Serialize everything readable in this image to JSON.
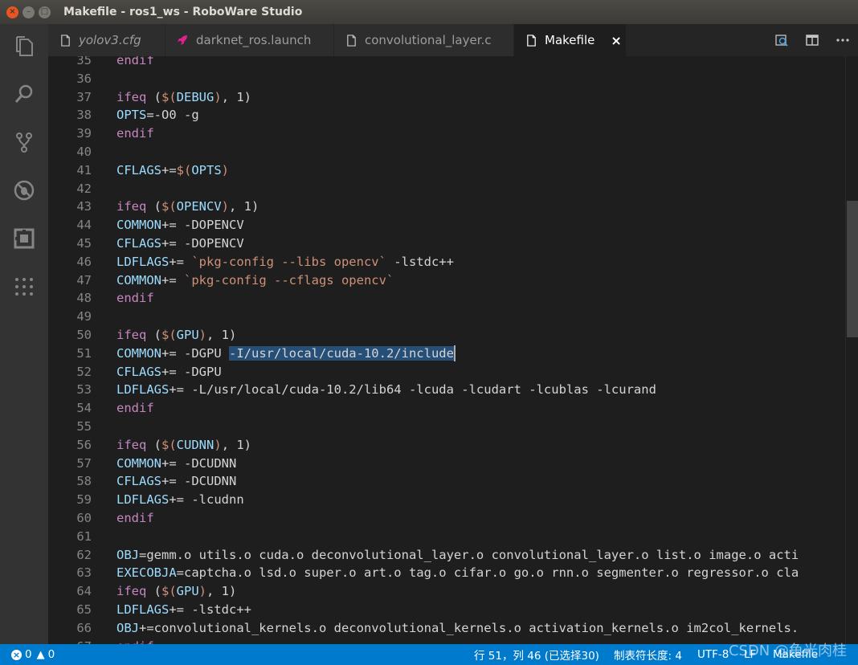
{
  "window": {
    "title": "Makefile - ros1_ws - RoboWare Studio"
  },
  "activity_bar": [
    {
      "icon": "files-icon"
    },
    {
      "icon": "search-icon"
    },
    {
      "icon": "source-control-icon"
    },
    {
      "icon": "debug-icon"
    },
    {
      "icon": "extensions-icon"
    },
    {
      "icon": "more-icon"
    }
  ],
  "tabs": [
    {
      "label": "yolov3.cfg",
      "icon": "file-icon",
      "italic": true,
      "active": false
    },
    {
      "label": "darknet_ros.launch",
      "icon": "rocket-icon",
      "italic": false,
      "active": false
    },
    {
      "label": "convolutional_layer.c",
      "icon": "file-icon",
      "italic": false,
      "active": false
    },
    {
      "label": "Makefile",
      "icon": "file-icon",
      "italic": false,
      "active": true,
      "close": "×"
    }
  ],
  "editor": {
    "lines": [
      {
        "n": "35",
        "text": "endif"
      },
      {
        "n": "36",
        "text": ""
      },
      {
        "n": "37",
        "text": "ifeq ($(DEBUG), 1)"
      },
      {
        "n": "38",
        "text": "OPTS=-O0 -g"
      },
      {
        "n": "39",
        "text": "endif"
      },
      {
        "n": "40",
        "text": ""
      },
      {
        "n": "41",
        "text": "CFLAGS+=$(OPTS)"
      },
      {
        "n": "42",
        "text": ""
      },
      {
        "n": "43",
        "text": "ifeq ($(OPENCV), 1)"
      },
      {
        "n": "44",
        "text": "COMMON+= -DOPENCV"
      },
      {
        "n": "45",
        "text": "CFLAGS+= -DOPENCV"
      },
      {
        "n": "46",
        "text": "LDFLAGS+= `pkg-config --libs opencv` -lstdc++"
      },
      {
        "n": "47",
        "text": "COMMON+= `pkg-config --cflags opencv`"
      },
      {
        "n": "48",
        "text": "endif"
      },
      {
        "n": "49",
        "text": ""
      },
      {
        "n": "50",
        "text": "ifeq ($(GPU), 1)"
      },
      {
        "n": "51",
        "text": "COMMON+= -DGPU -I/usr/local/cuda-10.2/include"
      },
      {
        "n": "52",
        "text": "CFLAGS+= -DGPU"
      },
      {
        "n": "53",
        "text": "LDFLAGS+= -L/usr/local/cuda-10.2/lib64 -lcuda -lcudart -lcublas -lcurand"
      },
      {
        "n": "54",
        "text": "endif"
      },
      {
        "n": "55",
        "text": ""
      },
      {
        "n": "56",
        "text": "ifeq ($(CUDNN), 1)"
      },
      {
        "n": "57",
        "text": "COMMON+= -DCUDNN"
      },
      {
        "n": "58",
        "text": "CFLAGS+= -DCUDNN"
      },
      {
        "n": "59",
        "text": "LDFLAGS+= -lcudnn"
      },
      {
        "n": "60",
        "text": "endif"
      },
      {
        "n": "61",
        "text": ""
      },
      {
        "n": "62",
        "text": "OBJ=gemm.o utils.o cuda.o deconvolutional_layer.o convolutional_layer.o list.o image.o acti"
      },
      {
        "n": "63",
        "text": "EXECOBJA=captcha.o lsd.o super.o art.o tag.o cifar.o go.o rnn.o segmenter.o regressor.o cla"
      },
      {
        "n": "64",
        "text": "ifeq ($(GPU), 1)"
      },
      {
        "n": "65",
        "text": "LDFLAGS+= -lstdc++"
      },
      {
        "n": "66",
        "text": "OBJ+=convolutional_kernels.o deconvolutional_kernels.o activation_kernels.o im2col_kernels."
      },
      {
        "n": "67",
        "text": "endif"
      }
    ],
    "selection": "-I/usr/local/cuda-10.2/include"
  },
  "status_bar": {
    "errors": "0",
    "warnings": "0",
    "position": "行 51，列 46 (已选择30)",
    "indent": "制表符长度: 4",
    "encoding": "UTF-8",
    "eol": "LF",
    "language": "Makefile"
  },
  "watermark": "CSDN @鱼光肉桂"
}
